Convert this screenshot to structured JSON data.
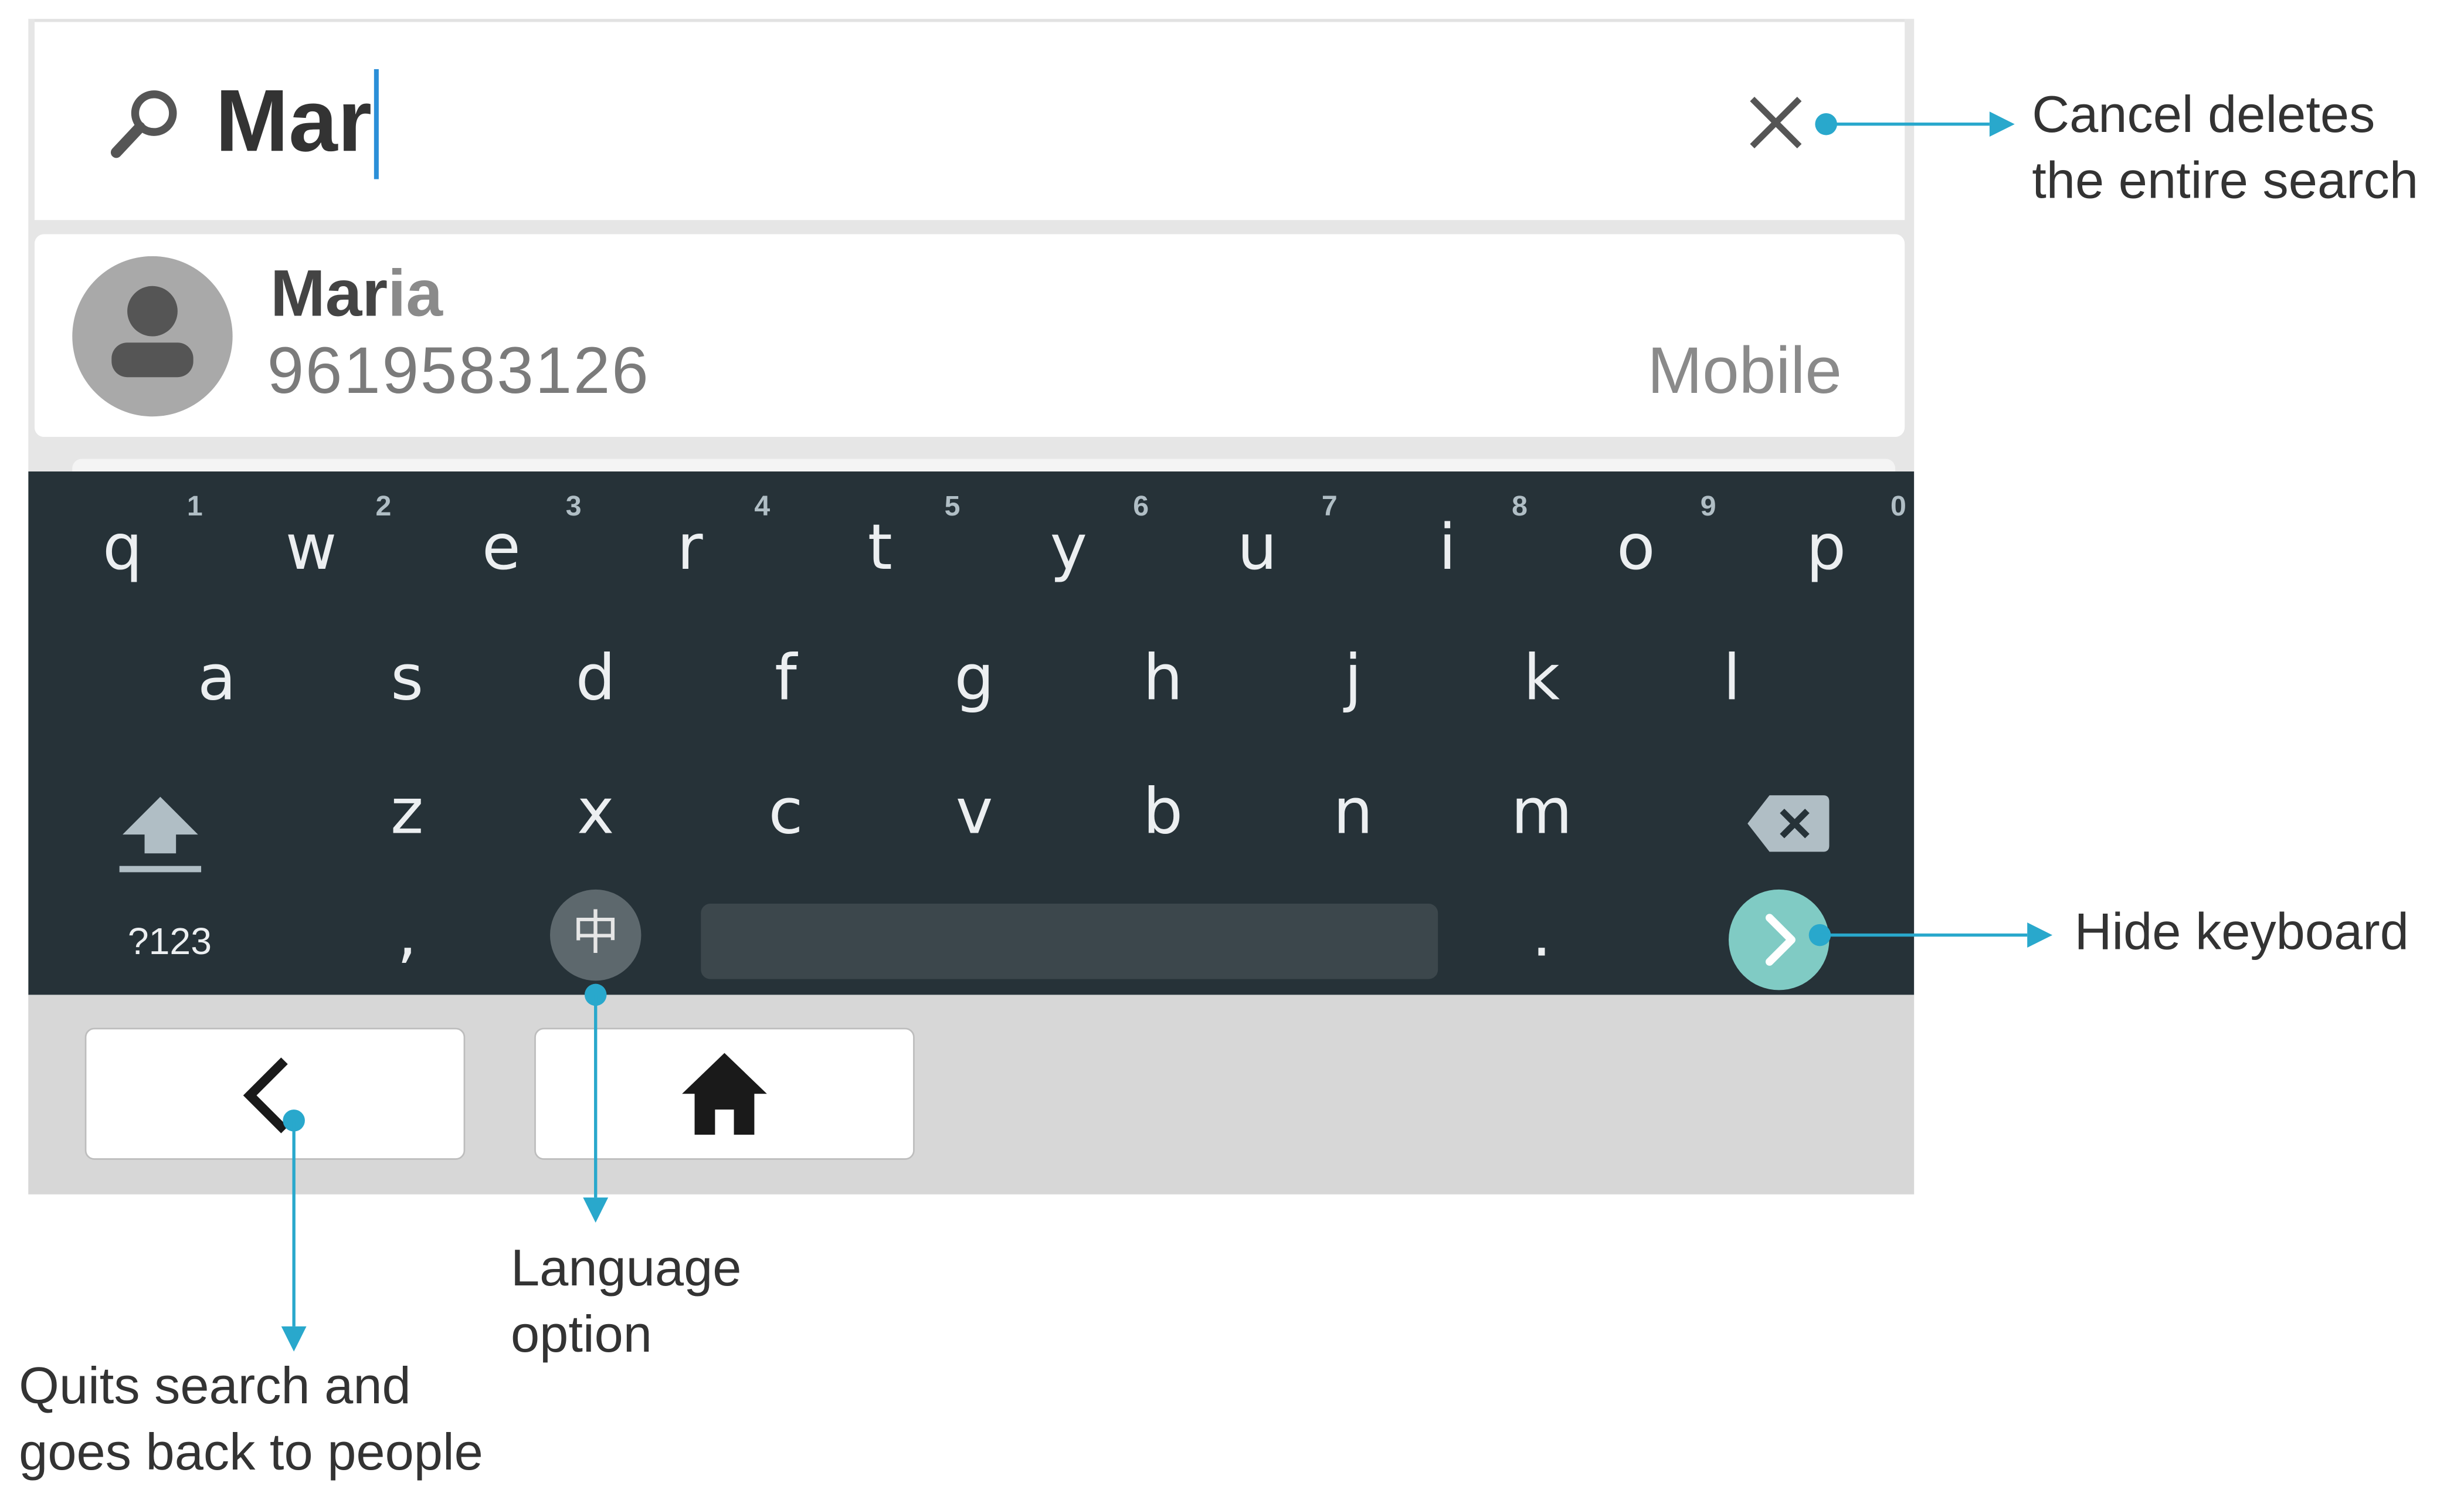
{
  "search": {
    "query": "Mar",
    "clear_icon": "close-icon",
    "search_icon": "search-icon"
  },
  "result": {
    "name_match": "Mar",
    "name_rest": "ia",
    "number": "9619583126",
    "type": "Mobile"
  },
  "keyboard": {
    "row1": [
      "q",
      "w",
      "e",
      "r",
      "t",
      "y",
      "u",
      "i",
      "o",
      "p"
    ],
    "row1_hints": [
      "1",
      "2",
      "3",
      "4",
      "5",
      "6",
      "7",
      "8",
      "9",
      "0"
    ],
    "row2": [
      "a",
      "s",
      "d",
      "f",
      "g",
      "h",
      "j",
      "k",
      "l"
    ],
    "row3": [
      "z",
      "x",
      "c",
      "v",
      "b",
      "n",
      "m"
    ],
    "symbols_label": "?123",
    "comma": ",",
    "period": ".",
    "language_key": "中",
    "shift_icon": "shift-icon",
    "backspace_icon": "backspace-icon",
    "go_icon": "chevron-right-icon"
  },
  "nav": {
    "back_icon": "chevron-left-icon",
    "home_icon": "home-icon"
  },
  "annotations": {
    "cancel_line1": "Cancel deletes",
    "cancel_line2": "the entire search",
    "hide_keyboard": "Hide keyboard",
    "language_line1": "Language",
    "language_line2": "option",
    "quit_line1": "Quits search and",
    "quit_line2": "goes back to people"
  },
  "colors": {
    "keyboard_bg": "#263238",
    "accent_teal": "#80cbc4",
    "annotation_line": "#29a8cc",
    "caret": "#2b8fd8"
  }
}
